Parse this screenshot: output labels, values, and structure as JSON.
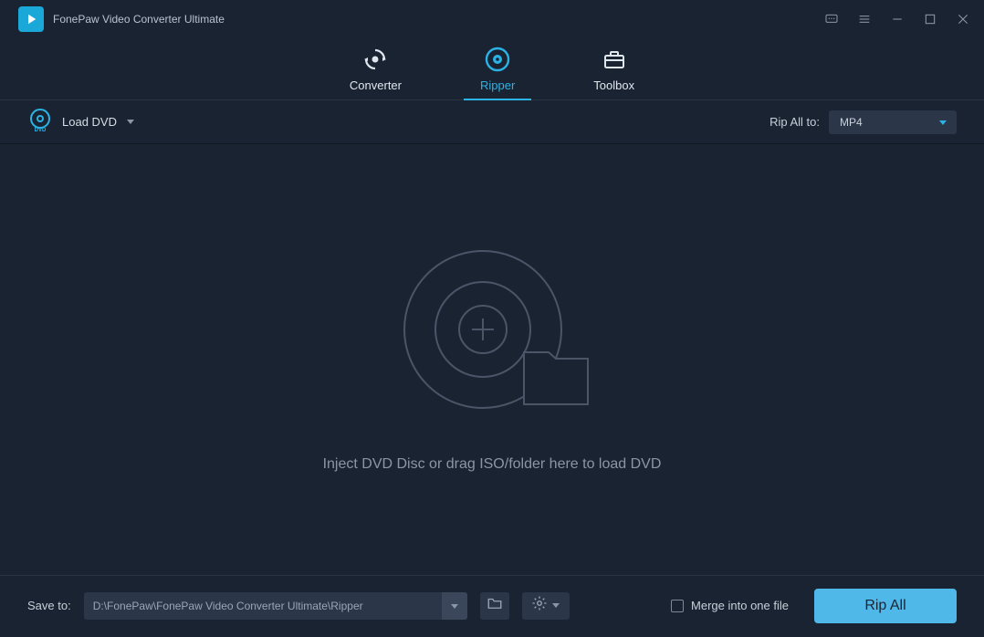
{
  "app": {
    "title": "FonePaw Video Converter Ultimate"
  },
  "tabs": {
    "converter": "Converter",
    "ripper": "Ripper",
    "toolbox": "Toolbox"
  },
  "toolbar": {
    "load_dvd": "Load DVD",
    "rip_all_to_label": "Rip All to:",
    "rip_format": "MP4"
  },
  "main": {
    "drop_hint": "Inject DVD Disc or drag ISO/folder here to load DVD"
  },
  "bottom": {
    "save_to_label": "Save to:",
    "save_path": "D:\\FonePaw\\FonePaw Video Converter Ultimate\\Ripper",
    "merge_label": "Merge into one file",
    "rip_all_button": "Rip All"
  }
}
